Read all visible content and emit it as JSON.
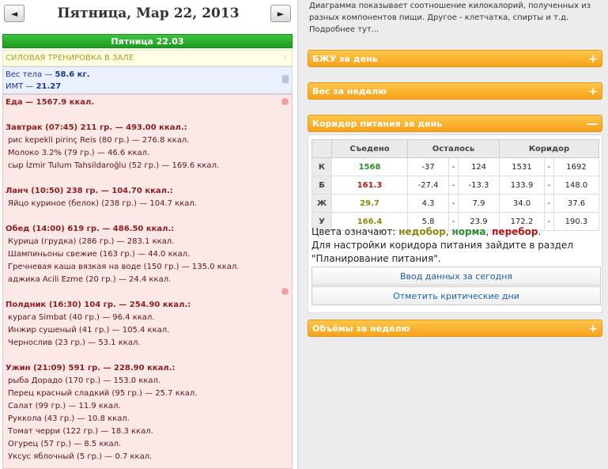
{
  "nav": {
    "prev": "◄",
    "next": "►",
    "date_title": "Пятница, Мар 22, 2013"
  },
  "day": {
    "header": "Пятница 22.03",
    "training": "СИЛОВАЯ ТРЕНИРОВКА В ЗАЛЕ",
    "weight_label": "Вес тела — ",
    "weight_value": "58.6 кг.",
    "bmi_label": "ИМТ — ",
    "bmi_value": "21.27",
    "food_total": "Еда — 1567.9 ккал."
  },
  "meals": [
    {
      "title": "Завтрак (07:45) 211 гр. — 493.00 ккал.:",
      "items": [
        "рис kepekli pirinç Reis (80 гр.) — 276.8 ккал.",
        "Молоко 3.2% (79 гр.) — 46.6 ккал.",
        "сыр İzmir Tulum Tahsildaroğlu (52 гр.) — 169.6 ккал."
      ]
    },
    {
      "title": "Ланч (10:50) 238 гр. — 104.70 ккал.:",
      "items": [
        "Яйцо куриное (белок) (238 гр.) — 104.7 ккал."
      ]
    },
    {
      "title": "Обед (14:00) 619 гр. — 486.50 ккал.:",
      "items": [
        "Курица (грудка) (286 гр.) — 283.1 ккал.",
        "Шампиньоны свежие (163 гр.) — 44.0 ккал.",
        "Гречневая каша вязкая на воде (150 гр.) — 135.0 ккал.",
        "аджика Acili Ezme (20 гр.) — 24.4 ккал."
      ]
    },
    {
      "title": "Полдник (16:30) 104 гр. — 254.90 ккал.:",
      "items": [
        "курага Simbat (40 гр.) — 96.4 ккал.",
        "Инжир сушеный (41 гр.) — 105.4 ккал.",
        "Чернослив (23 гр.) — 53.1 ккал."
      ]
    },
    {
      "title": "Ужин (21:09) 591 гр. — 228.90 ккал.:",
      "items": [
        "рыба Дорадо (170 гр.) — 153.0 ккал.",
        "Перец красный сладкий (95 гр.) — 25.7 ккал.",
        "Салат (99 гр.) — 11.9 ккал.",
        "Руккола (43 гр.) — 10.8 ккал.",
        "Томат черри (122 гр.) — 18.3 ккал.",
        "Огурец (57 гр.) — 8.5 ккал.",
        "Уксус яблочный (5 гр.) — 0.7 ккал."
      ]
    }
  ],
  "right": {
    "description": [
      "Диаграмма показывает соотношение килокалорий, полученных из",
      "разных компонентов пищи. Другое - клетчатка, спирты и т.д.",
      "Подробнее тут..."
    ],
    "panels": {
      "bju": "БЖУ за день",
      "weight_week": "Вес за неделю",
      "corridor": "Коридор питания за день",
      "volumes": "Объёмы за неделю"
    },
    "plus": "+",
    "minus": "—",
    "corridor_table": {
      "headers": [
        "Съедено",
        "Осталось",
        "Коридор"
      ],
      "rows": [
        {
          "label": "К",
          "eaten": "1568",
          "eaten_status": "green",
          "left_min": "-37",
          "left_max": "124",
          "corr_min": "1531",
          "corr_max": "1692"
        },
        {
          "label": "Б",
          "eaten": "161.3",
          "eaten_status": "red",
          "left_min": "-27.4",
          "left_max": "-13.3",
          "corr_min": "133.9",
          "corr_max": "148.0"
        },
        {
          "label": "Ж",
          "eaten": "29.7",
          "eaten_status": "olive",
          "left_min": "4.3",
          "left_max": "7.9",
          "corr_min": "34.0",
          "corr_max": "37.6"
        },
        {
          "label": "У",
          "eaten": "166.4",
          "eaten_status": "olive",
          "left_min": "5.8",
          "left_max": "23.9",
          "corr_min": "172.2",
          "corr_max": "190.3"
        }
      ],
      "dash": "-"
    },
    "legend": {
      "prefix": "Цвета означают: ",
      "under": "недобор",
      "sep1": ", ",
      "norm": "норма",
      "sep2": ", ",
      "over": "перебор",
      "end": ".",
      "line2": "Для настройки коридора питания зайдите в раздел",
      "line3": "\"Планирование питания\"."
    },
    "buttons": {
      "enter_today": "Ввод данных за сегодня",
      "mark_days": "Отметить критические дни"
    },
    "colors": {
      "green": "#2e8b2e",
      "red": "#b01818",
      "olive": "#8a8a10",
      "accent": "#f5a21a"
    }
  }
}
